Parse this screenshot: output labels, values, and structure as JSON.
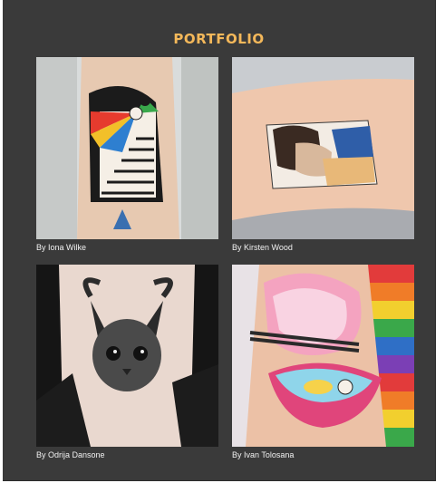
{
  "page": {
    "title": "PORTFOLIO"
  },
  "portfolio": {
    "items": [
      {
        "caption": "By Iona Wilke",
        "image": "tattoo-photo-staircase-rainbow-arch"
      },
      {
        "caption": "By Kirsten Wood",
        "image": "tattoo-photo-renaissance-painting-forearm"
      },
      {
        "caption": "By Odrija Dansone",
        "image": "tattoo-photo-horned-cat-blackwork"
      },
      {
        "caption": "By Ivan Tolosana",
        "image": "tattoo-photo-ramen-bowl-colorful"
      }
    ]
  },
  "colors": {
    "background": "#3a3a3a",
    "title": "#f4b85a",
    "caption": "#f2f2f2"
  }
}
